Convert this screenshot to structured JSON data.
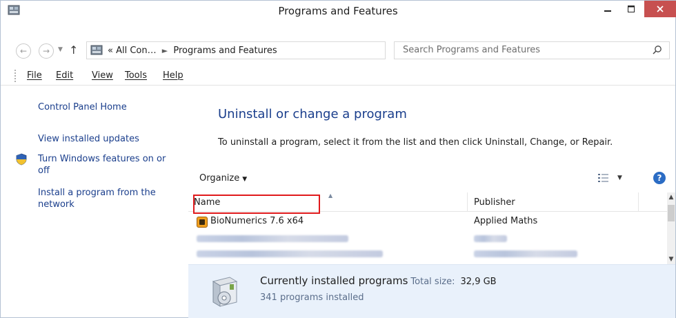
{
  "window": {
    "title": "Programs and Features",
    "close_glyph": "×"
  },
  "address": {
    "overflow": "«",
    "crumb1": "All Con…",
    "crumb2": "Programs and Features"
  },
  "search": {
    "placeholder": "Search Programs and Features"
  },
  "menu": {
    "file": "File",
    "edit": "Edit",
    "view": "View",
    "tools": "Tools",
    "help": "Help"
  },
  "sidebar": {
    "home": "Control Panel Home",
    "updates": "View installed updates",
    "features": "Turn Windows features on or off",
    "install": "Install a program from the network"
  },
  "main": {
    "title": "Uninstall or change a program",
    "description": "To uninstall a program, select it from the list and then click Uninstall, Change, or Repair."
  },
  "toolbar": {
    "organize": "Organize",
    "help_glyph": "?"
  },
  "list": {
    "columns": [
      "Name",
      "Publisher"
    ],
    "rows": [
      {
        "name": "BioNumerics 7.6 x64",
        "publisher": "Applied Maths"
      }
    ]
  },
  "details": {
    "title": "Currently installed programs",
    "size_label": "Total size:",
    "size_value": "32,9 GB",
    "count": "341 programs installed"
  },
  "colors": {
    "link": "#1a3e8c",
    "close_button": "#c75050",
    "highlight_box": "#e0191b",
    "details_bg": "#e9f1fb"
  }
}
